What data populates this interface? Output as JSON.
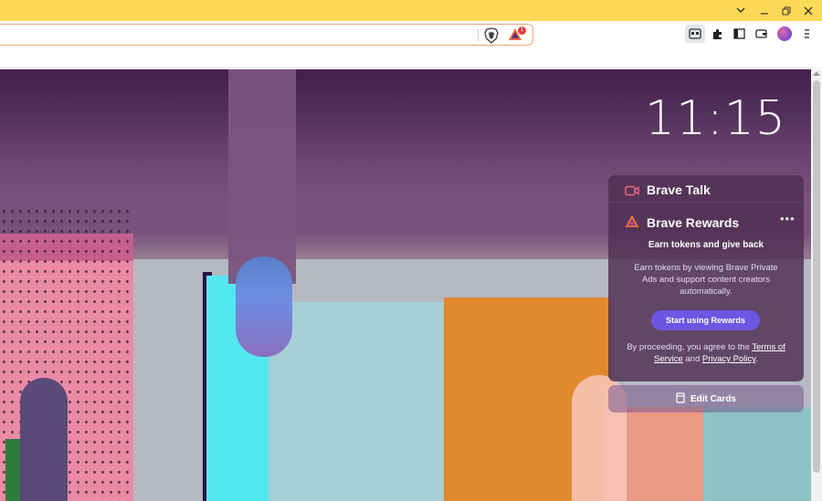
{
  "window": {
    "controls": {
      "chevron_icon": "chevron-down-icon",
      "minimize_icon": "minimize-icon",
      "restore_icon": "restore-icon",
      "close_icon": "close-icon"
    },
    "titlebar_color": "#fcd956"
  },
  "toolbar": {
    "address_value": "",
    "shields_icon": "brave-shields-icon",
    "rewards_icon": "brave-rewards-icon",
    "rewards_badge": "1",
    "buttons": [
      "tab-search-icon",
      "extensions-icon",
      "sidebar-icon",
      "wallet-icon",
      "profile-avatar",
      "menu-icon"
    ]
  },
  "ntp": {
    "clock": "11:15",
    "brave_talk": {
      "title": "Brave Talk"
    },
    "brave_rewards": {
      "title": "Brave Rewards",
      "more": "•••",
      "subtitle": "Earn tokens and give back",
      "description": "Earn tokens by viewing Brave Private Ads and support content creators automatically.",
      "cta": "Start using Rewards",
      "terms_prefix": "By proceeding, you agree to the",
      "terms_link": "Terms of Service",
      "terms_and": "and",
      "privacy_link": "Privacy Policy",
      "terms_suffix": "."
    },
    "edit_cards": "Edit Cards"
  },
  "colors": {
    "accent": "#6b57e3",
    "card_bg": "#4e2e52"
  }
}
